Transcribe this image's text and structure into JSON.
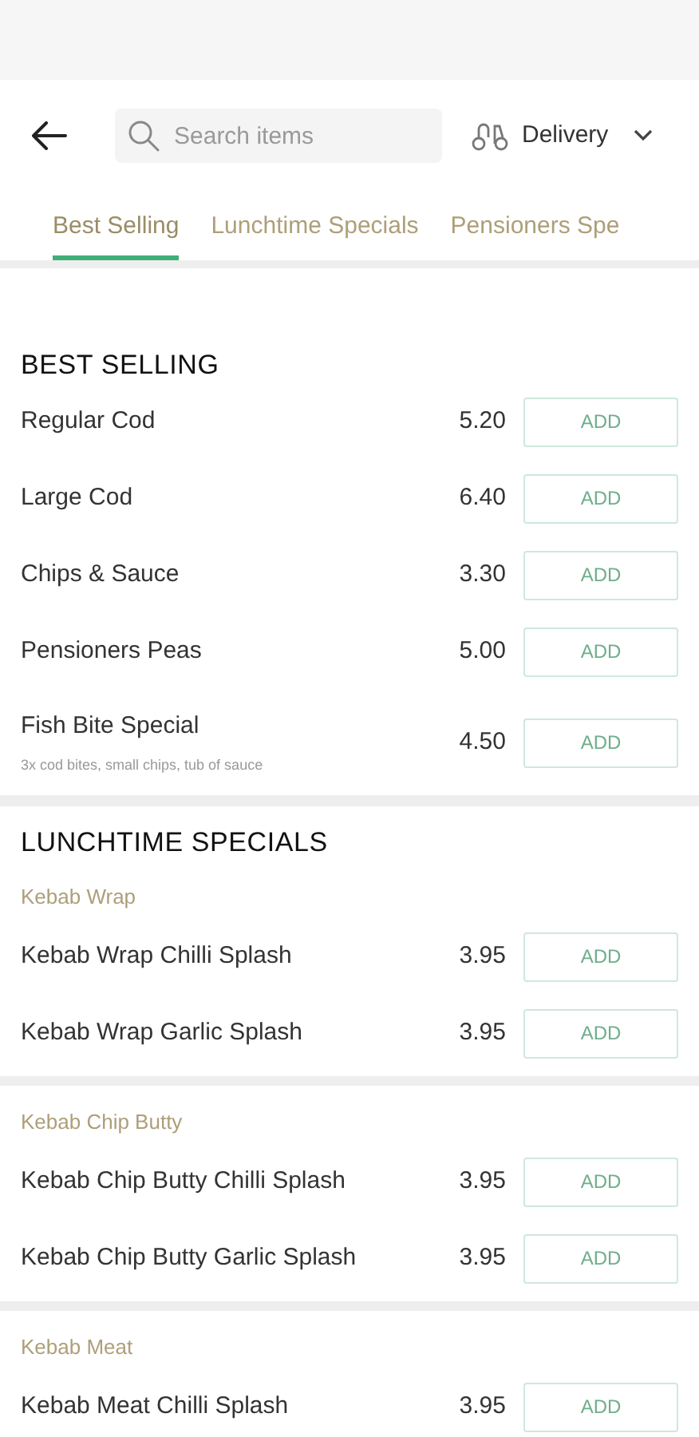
{
  "search": {
    "placeholder": "Search items"
  },
  "delivery": {
    "label": "Delivery"
  },
  "tabs": [
    {
      "label": "Best Selling",
      "selected": true
    },
    {
      "label": "Lunchtime Specials",
      "selected": false
    },
    {
      "label": "Pensioners Spe",
      "selected": false
    }
  ],
  "sections": [
    {
      "title": "BEST SELLING",
      "groups": [
        {
          "items": [
            {
              "name": "Regular Cod",
              "price": "5.20",
              "button": "ADD"
            },
            {
              "name": "Large Cod",
              "price": "6.40",
              "button": "ADD"
            },
            {
              "name": "Chips & Sauce",
              "price": "3.30",
              "button": "ADD"
            },
            {
              "name": "Pensioners Peas",
              "price": "5.00",
              "button": "ADD"
            },
            {
              "name": "Fish Bite Special",
              "description": "3x cod bites, small chips, tub of sauce",
              "price": "4.50",
              "button": "ADD"
            }
          ]
        }
      ]
    },
    {
      "title": "LUNCHTIME SPECIALS",
      "groups": [
        {
          "title": "Kebab Wrap",
          "items": [
            {
              "name": "Kebab Wrap Chilli Splash",
              "price": "3.95",
              "button": "ADD"
            },
            {
              "name": "Kebab Wrap Garlic Splash",
              "price": "3.95",
              "button": "ADD"
            }
          ]
        },
        {
          "title": "Kebab Chip Butty",
          "items": [
            {
              "name": "Kebab Chip Butty Chilli Splash",
              "price": "3.95",
              "button": "ADD"
            },
            {
              "name": "Kebab Chip Butty Garlic Splash",
              "price": "3.95",
              "button": "ADD"
            }
          ]
        },
        {
          "title": "Kebab Meat",
          "items": [
            {
              "name": "Kebab Meat Chilli Splash",
              "price": "3.95",
              "button": "ADD"
            }
          ]
        }
      ]
    }
  ]
}
